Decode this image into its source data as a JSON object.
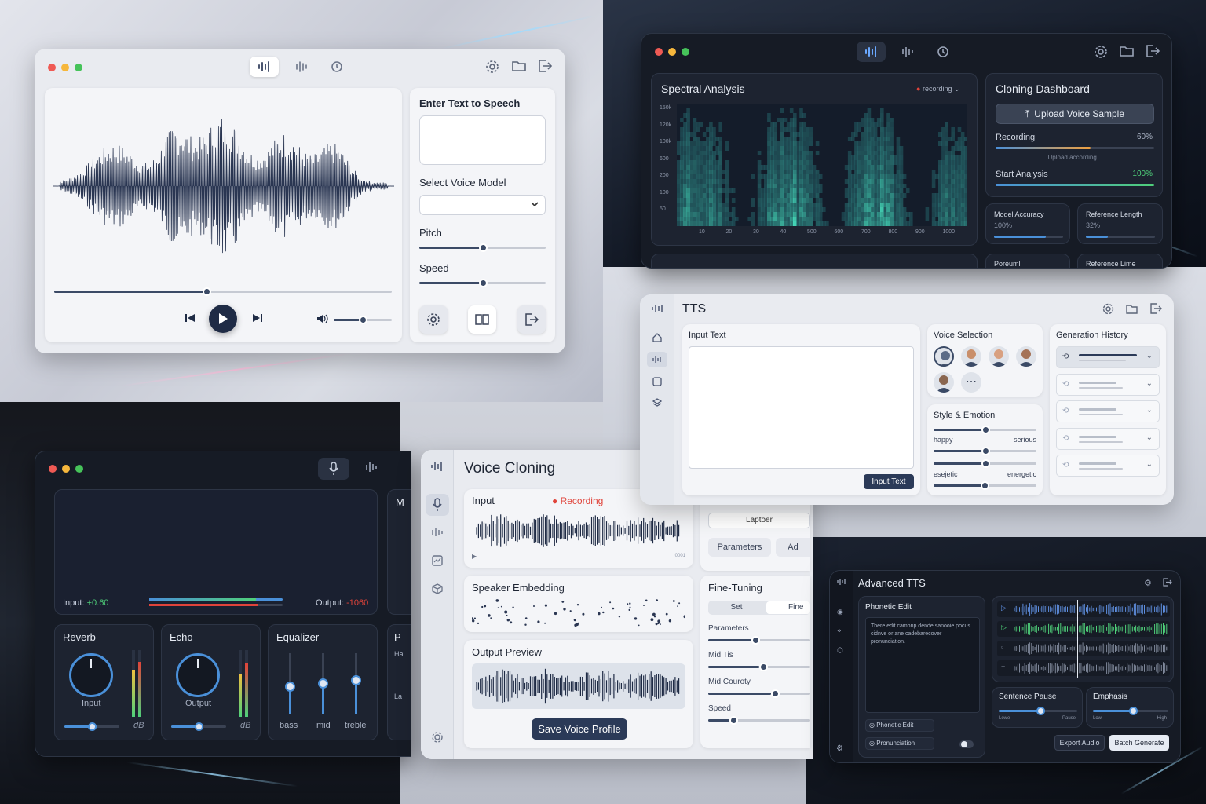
{
  "w1": {
    "input_title": "Enter Text to Speech",
    "voice_title": "Select Voice Model",
    "pitch": "Pitch",
    "speed": "Speed",
    "progress": 0.45,
    "volume": 0.5,
    "pitch_val": 0.5,
    "speed_val": 0.5
  },
  "w2": {
    "spectral_title": "Spectral Analysis",
    "recording": "recording",
    "yticks": [
      "150k",
      "120k",
      "100k",
      "600",
      "200",
      "100",
      "50"
    ],
    "xticks": [
      "10",
      "20",
      "30",
      "40",
      "500",
      "600",
      "700",
      "800",
      "900",
      "1000"
    ],
    "cloning_title": "Cloning Dashboard",
    "upload": "Upload Voice Sample",
    "recording_label": "Recording",
    "recording_pct": "60%",
    "recording_val": 0.6,
    "upload_note": "Upload according...",
    "start_label": "Start Analysis",
    "start_pct": "100%",
    "start_val": 1.0,
    "model_acc": "Model Accuracy",
    "model_acc_val": "100%",
    "ref_len": "Reference Length",
    "ref_len_val": "32%",
    "model_acc_fill": 0.75,
    "ref_len_fill": 0.32,
    "bottom1": "Poreuml",
    "bottom2": "Reference Lime"
  },
  "w3": {
    "title": "TTS",
    "input_text": "Input Text",
    "input_btn": "Input Text",
    "voice_sel": "Voice Selection",
    "style": "Style & Emotion",
    "happy": "happy",
    "serious": "serious",
    "esc": "esejetic",
    "energetic": "energetic",
    "history": "Generation History",
    "s1": 0.5,
    "s2": 0.5,
    "s3": 0.5
  },
  "w4": {
    "reverb": "Reverb",
    "echo": "Echo",
    "eq": "Equalizer",
    "input_knob": "Input",
    "output_knob": "Output",
    "db": "dB",
    "bass": "bass",
    "mid": "mid",
    "treble": "treble",
    "input_level": "Input:",
    "input_val": "+0.60",
    "output_level": "Output:",
    "output_val": "-1060",
    "col_m": "M",
    "col_p": "P",
    "col_h": "Ha",
    "col_l": "La"
  },
  "w5": {
    "title": "Voice Cloning",
    "input": "Input",
    "recording": "Recording",
    "time": "0001",
    "speaker": "Speaker Embedding",
    "output": "Output Preview",
    "save": "Save Voice Profile",
    "laptoer": "Laptoer",
    "params_btn": "Parameters",
    "ad": "Ad",
    "finetune": "Fine-Tuning",
    "set": "Set",
    "fine": "Fine",
    "params": "Parameters",
    "midtis": "Mid Tis",
    "midcur": "Mid Couroty",
    "speed": "Speed",
    "colors": {
      "recording": "#e0433a"
    }
  },
  "w6": {
    "title": "Advanced TTS",
    "phonetic_title": "Phonetic Edit",
    "phonetic_text": "There edit camonp dende sanooie pocus cidnve or ane cadebarecover pronunciation.",
    "ph_edit": "Phonetic Edit",
    "pronunciation": "Pronunciation",
    "sentence_pause": "Sentence Pause",
    "low": "Lowe",
    "pause": "Pause",
    "emphasis": "Emphasis",
    "low2": "Low",
    "high": "High",
    "export": "Export Audio",
    "batch": "Batch Generate"
  }
}
